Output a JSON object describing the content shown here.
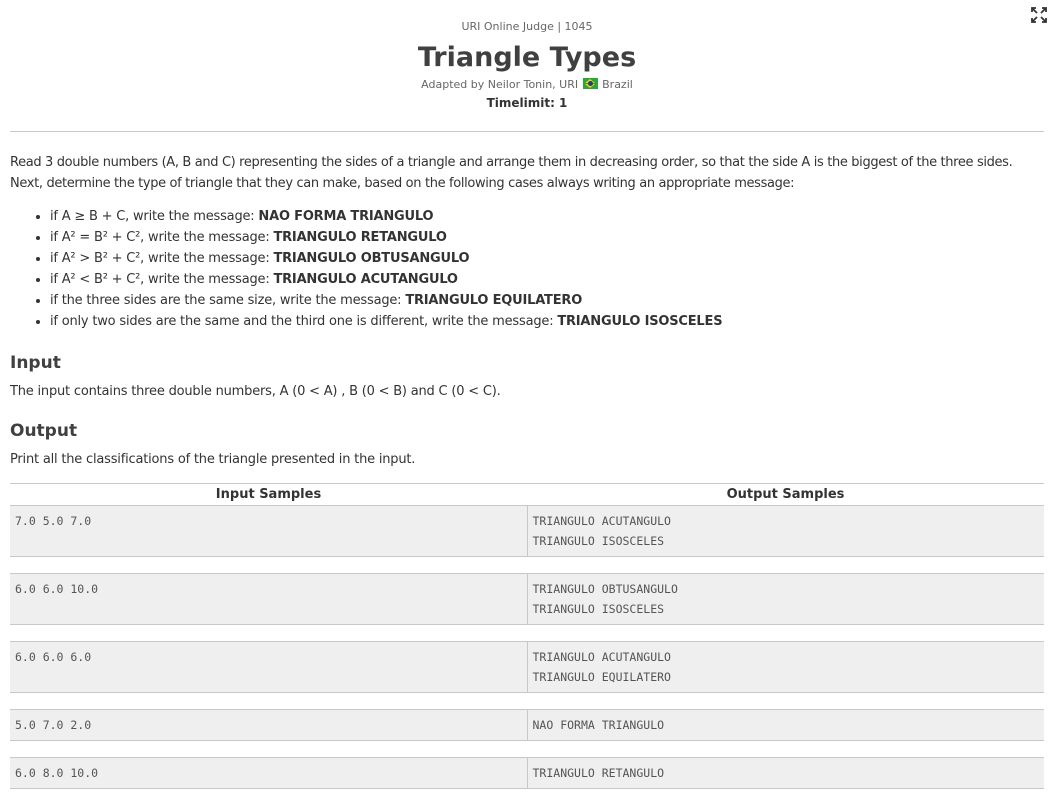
{
  "header": {
    "judge": "URI Online Judge | 1045",
    "title": "Triangle Types",
    "author_prefix": "Adapted by Neilor Tonin, URI",
    "author_country": "Brazil",
    "flag_icon": "brazil-flag-icon",
    "timelimit": "Timelimit: 1"
  },
  "description": {
    "line1": "Read 3 double numbers (A, B and C) representing the sides of a triangle and arrange them in decreasing order, so that the side A is the biggest of the three sides.",
    "line2": "Next, determine the type of triangle that they can make, based on the following cases always writing an appropriate message:"
  },
  "cases": [
    {
      "condition": "if A ≥ B + C, write the message: ",
      "message": "NAO FORMA TRIANGULO"
    },
    {
      "condition": "if A² = B² + C², write the message: ",
      "message": "TRIANGULO RETANGULO"
    },
    {
      "condition": "if A² > B² + C², write the message: ",
      "message": "TRIANGULO OBTUSANGULO"
    },
    {
      "condition": "if A² < B² + C², write the message: ",
      "message": "TRIANGULO ACUTANGULO"
    },
    {
      "condition": "if the three sides are the same size, write the message: ",
      "message": "TRIANGULO EQUILATERO"
    },
    {
      "condition": "if only two sides are the same and the third one is different, write the message: ",
      "message": "TRIANGULO ISOSCELES"
    }
  ],
  "input_section": {
    "heading": "Input",
    "text": "The input contains three double numbers, A (0 < A) , B (0 < B) and C (0 < C)."
  },
  "output_section": {
    "heading": "Output",
    "text": "Print all the classifications of the triangle presented in the input."
  },
  "samples": {
    "input_header": "Input Samples",
    "output_header": "Output Samples",
    "rows": [
      {
        "input": "7.0 5.0 7.0",
        "output": "TRIANGULO ACUTANGULO\nTRIANGULO ISOSCELES"
      },
      {
        "input": "6.0 6.0 10.0",
        "output": "TRIANGULO OBTUSANGULO\nTRIANGULO ISOSCELES"
      },
      {
        "input": "6.0 6.0 6.0",
        "output": "TRIANGULO ACUTANGULO\nTRIANGULO EQUILATERO"
      },
      {
        "input": "5.0 7.0 2.0",
        "output": "NAO FORMA TRIANGULO"
      },
      {
        "input": "6.0 8.0 10.0",
        "output": "TRIANGULO RETANGULO"
      }
    ]
  },
  "toolbar": {
    "fullscreen_icon": "fullscreen-icon"
  }
}
